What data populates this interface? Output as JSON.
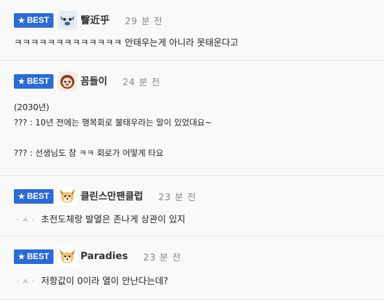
{
  "comments": [
    {
      "badge": "BEST",
      "nick": "瞖近乎",
      "time": "29 분 전",
      "lines": [
        "ㅋㅋㅋㅋㅋㅋㅋㅋㅋㅋㅋㅋㅋ 안태우는게 아니라 못태운다고"
      ]
    },
    {
      "badge": "BEST",
      "nick": "꼼돌이",
      "time": "24 분 전",
      "lines": [
        "(2030년)",
        "??? : 10년 전에는 행복회로 불태우라는 말이 있었대요~",
        "??? : 선생님도 참 ㅋㅋ 회로가 어떻게 타요"
      ]
    },
    {
      "badge": "BEST",
      "nick": "클린스만팬클럽",
      "time": "23 분 전",
      "reply_marker": "ㆍㅅㆍ",
      "lines": [
        "초전도체랑 발열은 존나게 상관이 있지"
      ]
    },
    {
      "badge": "BEST",
      "nick": "Paradies",
      "time": "23 분 전",
      "reply_marker": "ㆍㅅㆍ",
      "lines": [
        "저항값이 0이라 열이 안난다는데?"
      ]
    }
  ],
  "colors": {
    "badge_bg": "#2c6bd0",
    "row_bg": "#f9f9f9",
    "divider": "#e4e4e4"
  },
  "icons": {
    "badge": "star-icon"
  }
}
